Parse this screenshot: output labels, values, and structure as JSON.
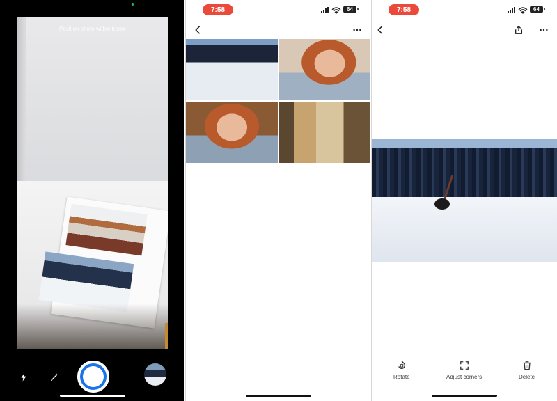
{
  "camera": {
    "hint": "Position photo within frame",
    "icons": {
      "flash": "flash-icon",
      "enhance": "magic-wand-icon",
      "shutter": "shutter-button",
      "last_scan": "thumbnail"
    }
  },
  "status_bar": {
    "time": "7:58",
    "battery": "64"
  },
  "gallery": {
    "icons": {
      "back": "back-arrow-icon",
      "more": "more-dots-icon"
    },
    "thumbnails": [
      "snow-scene",
      "girl-knitting",
      "girl-knitting",
      "family-room"
    ]
  },
  "preview": {
    "icons": {
      "back": "back-arrow-icon",
      "share": "share-icon",
      "more": "more-dots-icon"
    },
    "actions": {
      "rotate": "Rotate",
      "adjust": "Adjust corners",
      "delete": "Delete"
    }
  },
  "colors": {
    "accent": "#1a73e8",
    "time_pill": "#eb4a3b"
  }
}
